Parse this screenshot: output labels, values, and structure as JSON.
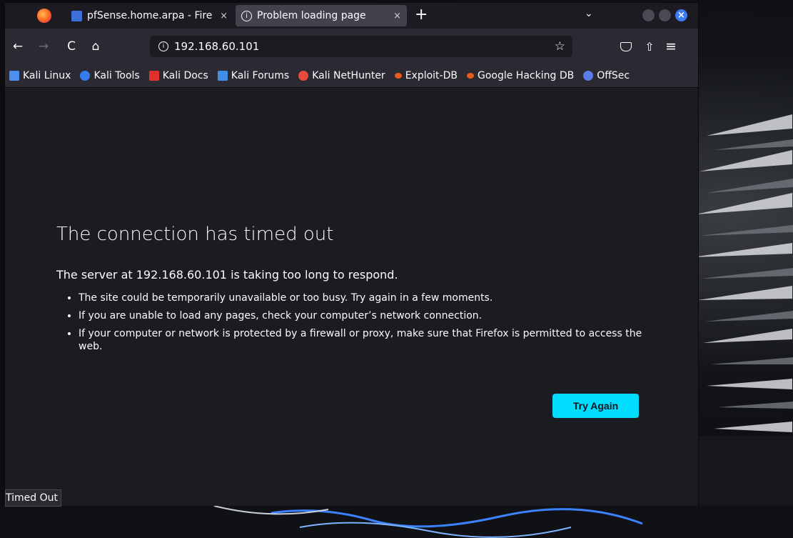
{
  "tabs": [
    {
      "label": "pfSense.home.arpa - Fire",
      "icon": "pfsense-favicon",
      "active": false
    },
    {
      "label": "Problem loading page",
      "icon": "info-icon",
      "active": true
    }
  ],
  "tab_close_glyph": "×",
  "new_tab_glyph": "+",
  "toolbar": {
    "url": "192.168.60.101",
    "back_glyph": "←",
    "forward_glyph": "→",
    "reload_glyph": "C",
    "home_glyph": "⌂",
    "star_glyph": "☆",
    "menu_glyph": "≡"
  },
  "bookmarks": [
    {
      "label": "Kali Linux",
      "color": "#4d8ff0"
    },
    {
      "label": "Kali Tools",
      "color": "#367bf0"
    },
    {
      "label": "Kali Docs",
      "color": "#e0312f"
    },
    {
      "label": "Kali Forums",
      "color": "#3f8fe8"
    },
    {
      "label": "Kali NetHunter",
      "color": "#e84a3c"
    },
    {
      "label": "Exploit-DB",
      "color": "#e85c1e"
    },
    {
      "label": "Google Hacking DB",
      "color": "#e85c1e"
    },
    {
      "label": "OffSec",
      "color": "#5a7be8"
    }
  ],
  "error": {
    "title": "The connection has timed out",
    "lead": "The server at 192.168.60.101 is taking too long to respond.",
    "bullets": [
      "The site could be temporarily unavailable or too busy. Try again in a few moments.",
      "If you are unable to load any pages, check your computer’s network connection.",
      "If your computer or network is protected by a firewall or proxy, make sure that Firefox is permitted to access the web."
    ],
    "button": "Try Again"
  },
  "status": "Timed Out",
  "colors": {
    "accent": "#00ddff",
    "window_bg": "#1c1b22",
    "toolbar_bg": "#2b2a33"
  }
}
